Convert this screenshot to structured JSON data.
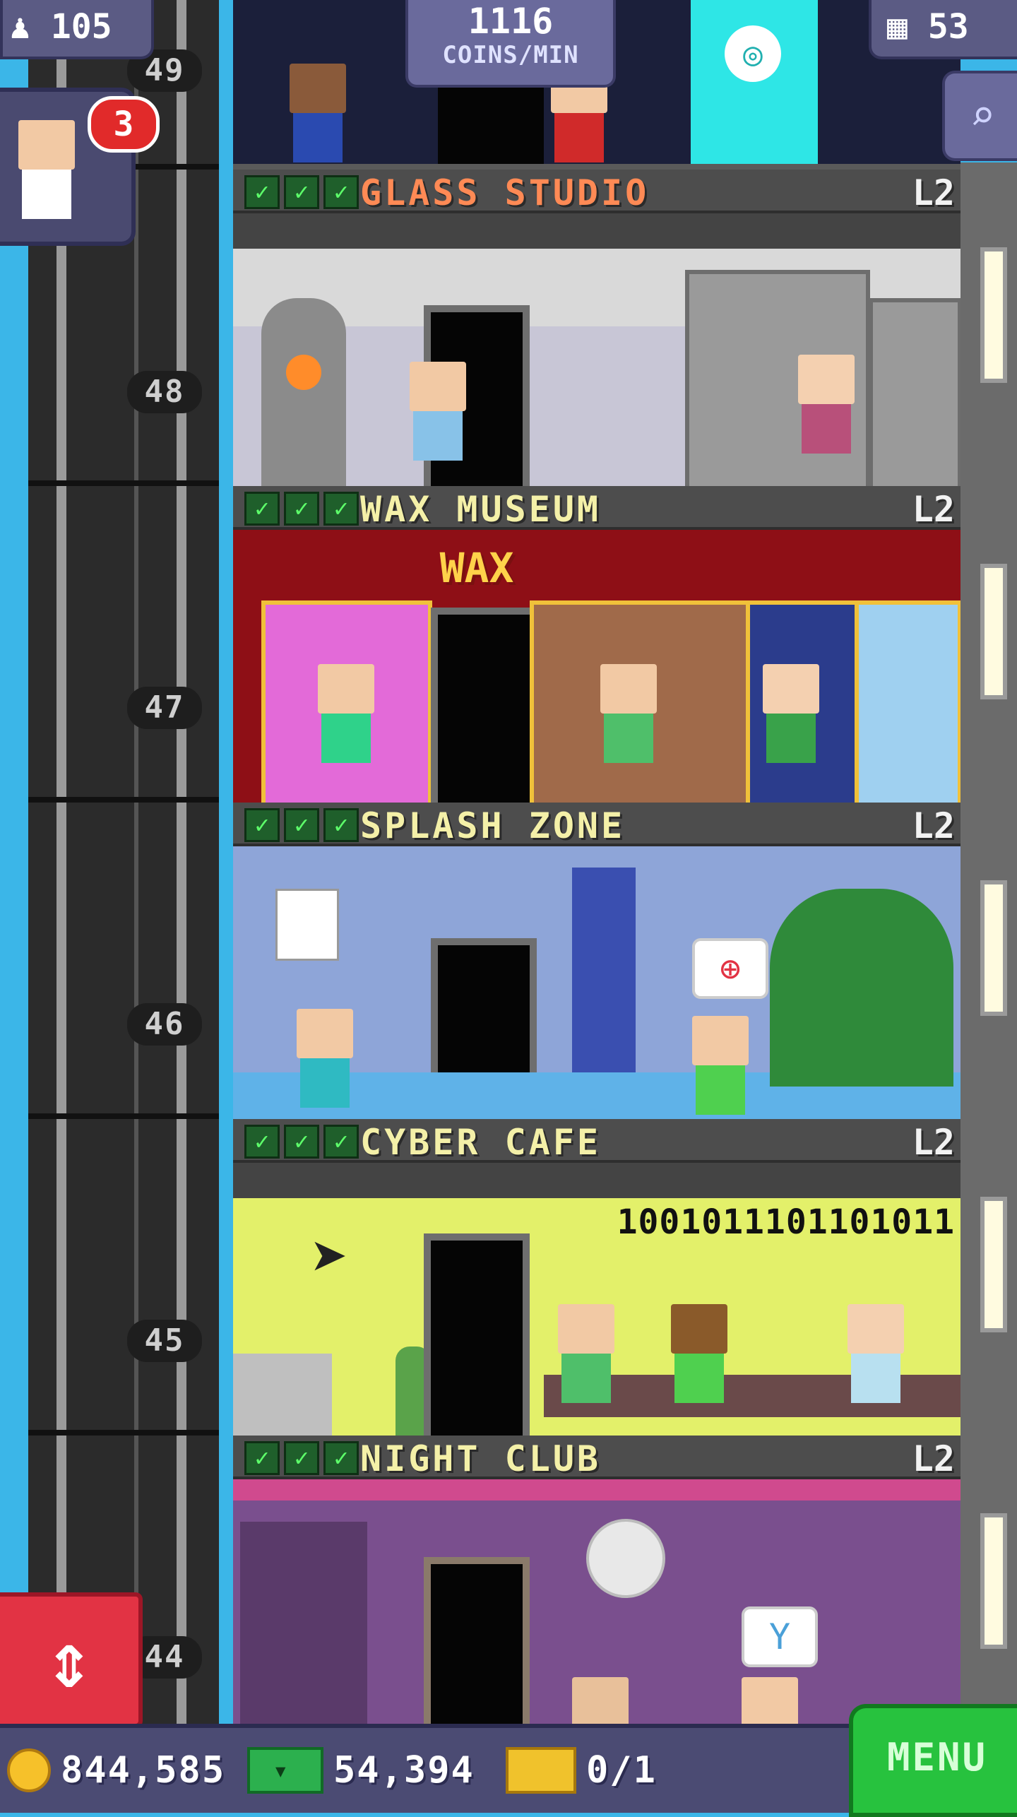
{
  "hud": {
    "population": "105",
    "coins_per_min_value": "1116",
    "coins_per_min_label": "COINS/MIN",
    "floor_count": "53",
    "visitor_badge_count": "3"
  },
  "top_floor": {
    "partial_floor_number": "49"
  },
  "floor_numbers": [
    "48",
    "47",
    "46",
    "45",
    "44"
  ],
  "floors": [
    {
      "name": "GLASS STUDIO",
      "level": "L2",
      "checks": 3
    },
    {
      "name": "WAX MUSEUM",
      "level": "L2",
      "checks": 3,
      "sign": "WAX"
    },
    {
      "name": "SPLASH ZONE",
      "level": "L2",
      "checks": 3
    },
    {
      "name": "CYBER CAFE",
      "level": "L2",
      "checks": 3,
      "binary": "1001011101101011"
    },
    {
      "name": "NIGHT CLUB",
      "level": "L2",
      "checks": 3
    }
  ],
  "bottom_bar": {
    "coins": "844,585",
    "tower_bux": "54,394",
    "tickets": "0/1",
    "menu_label": "MENU"
  },
  "colors": {
    "hud_purple": "#5b5b84",
    "menu_green": "#27c23e",
    "elevator_red": "#e23344",
    "sky_blue": "#3bb6e8",
    "check_green": "#5dff6a"
  },
  "icons": {
    "population": "person-icon",
    "floors": "building-icon",
    "search": "magnifier-icon",
    "elevator": "up-down-arrows-icon",
    "coin": "coin-icon",
    "bux": "tower-bux-icon",
    "ticket": "vip-ticket-icon"
  }
}
